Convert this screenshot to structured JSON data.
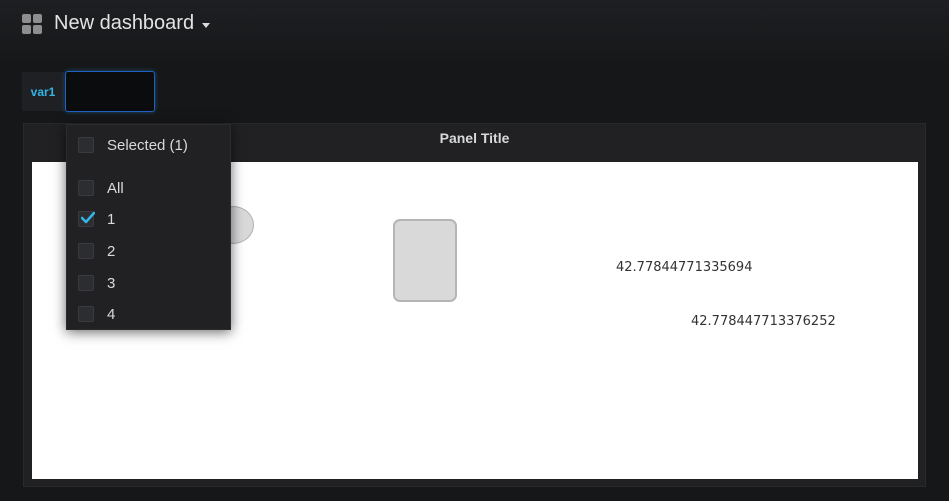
{
  "header": {
    "title": "New dashboard",
    "icon": "grid-icon",
    "caret": "chevron-down-icon"
  },
  "variable": {
    "label": "var1",
    "value": ""
  },
  "panel": {
    "title": "Panel Title",
    "value_1": "42.77844771335694",
    "value_2": "42.77844771337625​2"
  },
  "dropdown": {
    "selected_label": "Selected (1)",
    "options": [
      {
        "label": "All",
        "checked": false
      },
      {
        "label": "1",
        "checked": true
      },
      {
        "label": "2",
        "checked": false
      },
      {
        "label": "3",
        "checked": false
      },
      {
        "label": "4",
        "checked": false
      }
    ]
  },
  "colors": {
    "accent": "#33b5e5",
    "focus_border": "#1f60c4",
    "background": "#161719"
  }
}
